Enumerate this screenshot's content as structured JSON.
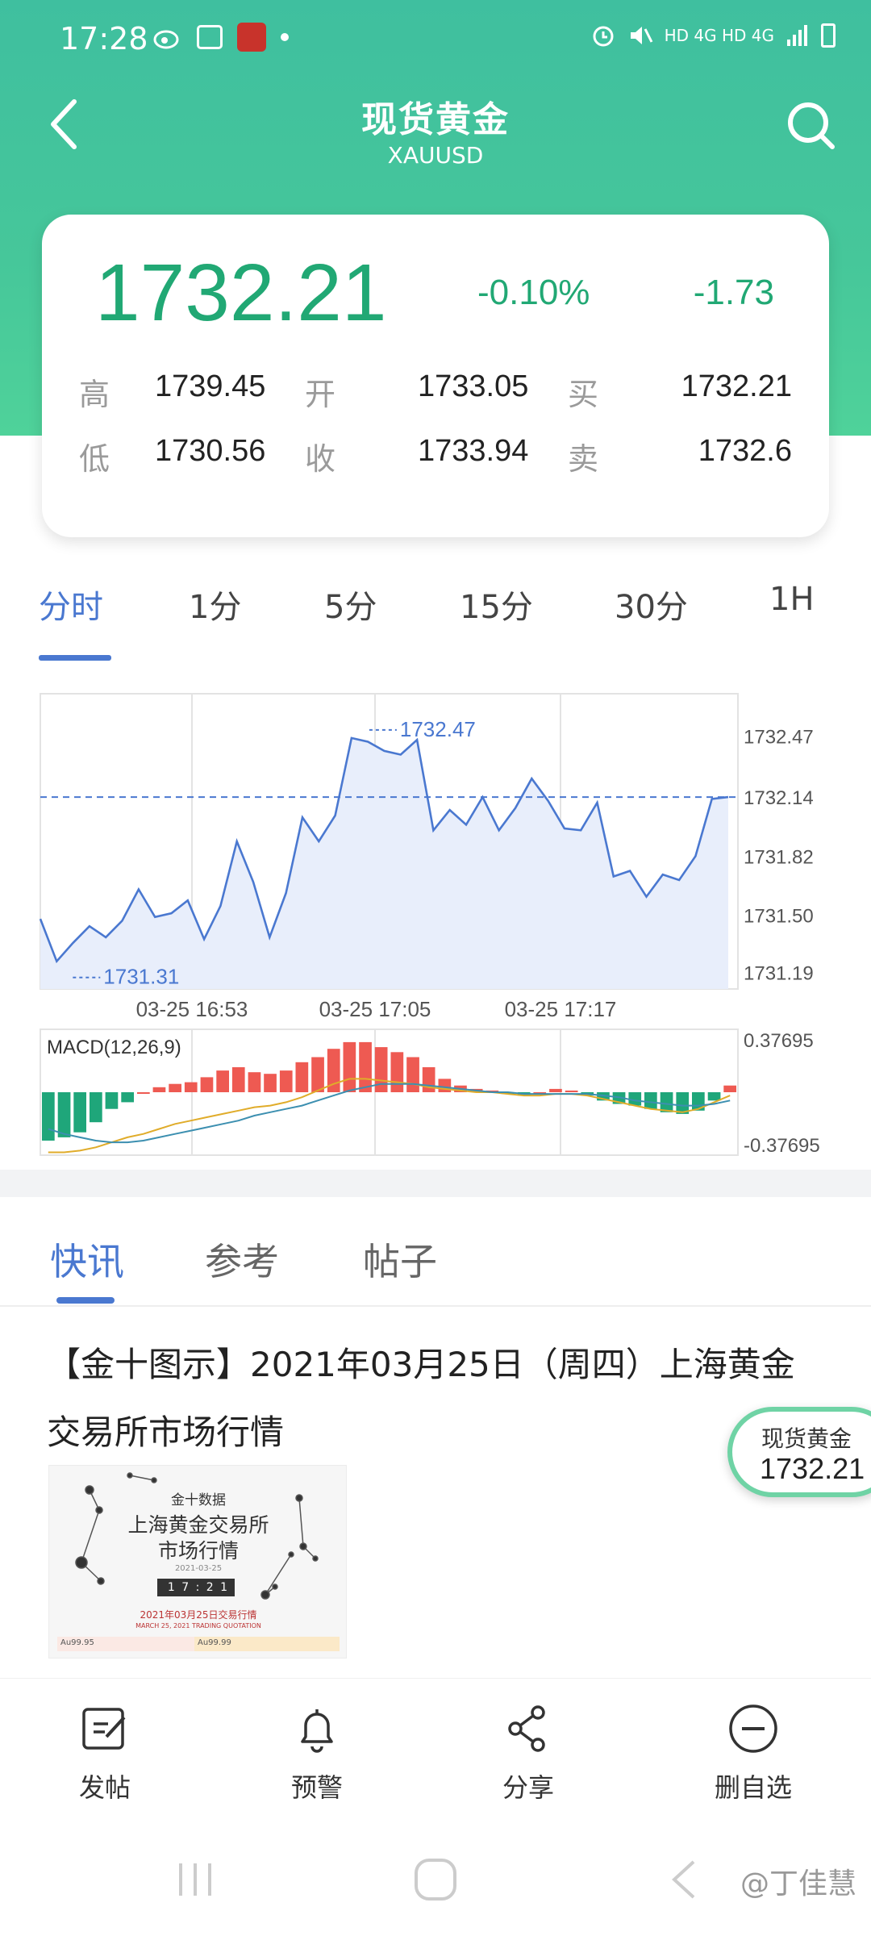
{
  "status_bar": {
    "time": "17:28",
    "right_text": "HD 4G HD 4G"
  },
  "nav": {
    "title": "现货黄金",
    "subtitle": "XAUUSD"
  },
  "quote": {
    "price": "1732.21",
    "change_pct": "-0.10%",
    "change_abs": "-1.73",
    "high_label": "高",
    "high_value": "1739.45",
    "open_label": "开",
    "open_value": "1733.05",
    "buy_label": "买",
    "buy_value": "1732.21",
    "low_label": "低",
    "low_value": "1730.56",
    "close_label": "收",
    "close_value": "1733.94",
    "sell_label": "卖",
    "sell_value": "1732.6",
    "color_green": "#21a874"
  },
  "period_tabs": [
    "分时",
    "1分",
    "5分",
    "15分",
    "30分",
    "1H"
  ],
  "chart_data": [
    {
      "type": "line",
      "title": "",
      "x": [
        "03-25 16:53",
        "03-25 17:05",
        "03-25 17:17"
      ],
      "y_ticks": [
        "1732.47",
        "1732.14",
        "1731.82",
        "1731.50",
        "1731.19"
      ],
      "ylim": [
        1731.1,
        1732.7
      ],
      "reference_line": 1732.14,
      "max_label": "1732.47",
      "min_label": "1731.31",
      "series": [
        {
          "values": [
            1731.48,
            1731.25,
            1731.35,
            1731.44,
            1731.38,
            1731.47,
            1731.64,
            1731.49,
            1731.51,
            1731.58,
            1731.37,
            1731.55,
            1731.9,
            1731.68,
            1731.38,
            1731.62,
            1732.03,
            1731.9,
            1732.04,
            1732.46,
            1732.44,
            1732.39,
            1732.37,
            1732.45,
            1731.96,
            1732.07,
            1731.99,
            1732.14,
            1731.96,
            1732.08,
            1732.24,
            1732.12,
            1731.97,
            1731.96,
            1732.11,
            1731.71,
            1731.74,
            1731.6,
            1731.72,
            1731.69,
            1731.82,
            1732.13,
            1732.14
          ]
        }
      ],
      "colors": {
        "line": "#4a78d0",
        "fill": "#e8eefb",
        "grid": "#e3e3e3"
      }
    },
    {
      "type": "bar",
      "title": "MACD(12,26,9)",
      "y_ticks": [
        "0.37695",
        "-0.37695"
      ],
      "ylim": [
        -0.37695,
        0.37695
      ],
      "histogram": [
        -0.29,
        -0.27,
        -0.24,
        -0.18,
        -0.1,
        -0.06,
        0.0,
        0.03,
        0.05,
        0.06,
        0.09,
        0.13,
        0.15,
        0.12,
        0.11,
        0.13,
        0.18,
        0.21,
        0.26,
        0.3,
        0.3,
        0.27,
        0.24,
        0.21,
        0.15,
        0.08,
        0.04,
        0.02,
        0.01,
        -0.01,
        -0.02,
        0.0,
        0.02,
        0.01,
        -0.02,
        -0.05,
        -0.07,
        -0.08,
        -0.1,
        -0.12,
        -0.13,
        -0.11,
        -0.05,
        0.04
      ],
      "dif": [
        -0.36,
        -0.36,
        -0.35,
        -0.33,
        -0.3,
        -0.27,
        -0.25,
        -0.22,
        -0.19,
        -0.17,
        -0.15,
        -0.13,
        -0.11,
        -0.09,
        -0.08,
        -0.06,
        -0.03,
        0.01,
        0.05,
        0.08,
        0.08,
        0.07,
        0.06,
        0.05,
        0.03,
        0.02,
        0.01,
        0.0,
        0.0,
        -0.01,
        -0.02,
        -0.02,
        -0.01,
        -0.01,
        -0.02,
        -0.04,
        -0.06,
        -0.08,
        -0.1,
        -0.11,
        -0.12,
        -0.1,
        -0.06,
        -0.02
      ],
      "dea": [
        -0.22,
        -0.25,
        -0.27,
        -0.29,
        -0.3,
        -0.3,
        -0.29,
        -0.27,
        -0.25,
        -0.23,
        -0.21,
        -0.19,
        -0.17,
        -0.14,
        -0.12,
        -0.1,
        -0.08,
        -0.05,
        -0.02,
        0.01,
        0.03,
        0.05,
        0.05,
        0.05,
        0.04,
        0.03,
        0.02,
        0.01,
        0.0,
        0.0,
        -0.01,
        -0.01,
        -0.01,
        -0.01,
        -0.01,
        -0.02,
        -0.03,
        -0.05,
        -0.06,
        -0.07,
        -0.08,
        -0.08,
        -0.07,
        -0.05
      ],
      "colors": {
        "positive": "#ee5a52",
        "negative": "#1fa67a",
        "dif": "#e0ac2a",
        "dea": "#3c8fb0"
      }
    }
  ],
  "news_tabs": [
    "快讯",
    "参考",
    "帖子"
  ],
  "article": {
    "title": "【金十图示】2021年03月25日（周四）上海黄金交易所市场行情",
    "thumb": {
      "line1": "金十数据",
      "line2": "上海黄金交易所",
      "line3": "市场行情",
      "date": "2021-03-25",
      "clock": "1 7 : 2 1",
      "caption": "2021年03月25日交易行情",
      "caption_en": "MARCH 25, 2021 TRADING QUOTATION",
      "left_tag": "Au99.95",
      "right_tag": "Au99.99"
    }
  },
  "float_pill": {
    "label": "现货黄金",
    "value": "1732.21"
  },
  "bottom_bar": [
    {
      "label": "发帖",
      "icon": "edit-icon"
    },
    {
      "label": "预警",
      "icon": "bell-icon"
    },
    {
      "label": "分享",
      "icon": "share-icon"
    },
    {
      "label": "删自选",
      "icon": "remove-circle-icon"
    }
  ],
  "watermark": "@丁佳慧"
}
